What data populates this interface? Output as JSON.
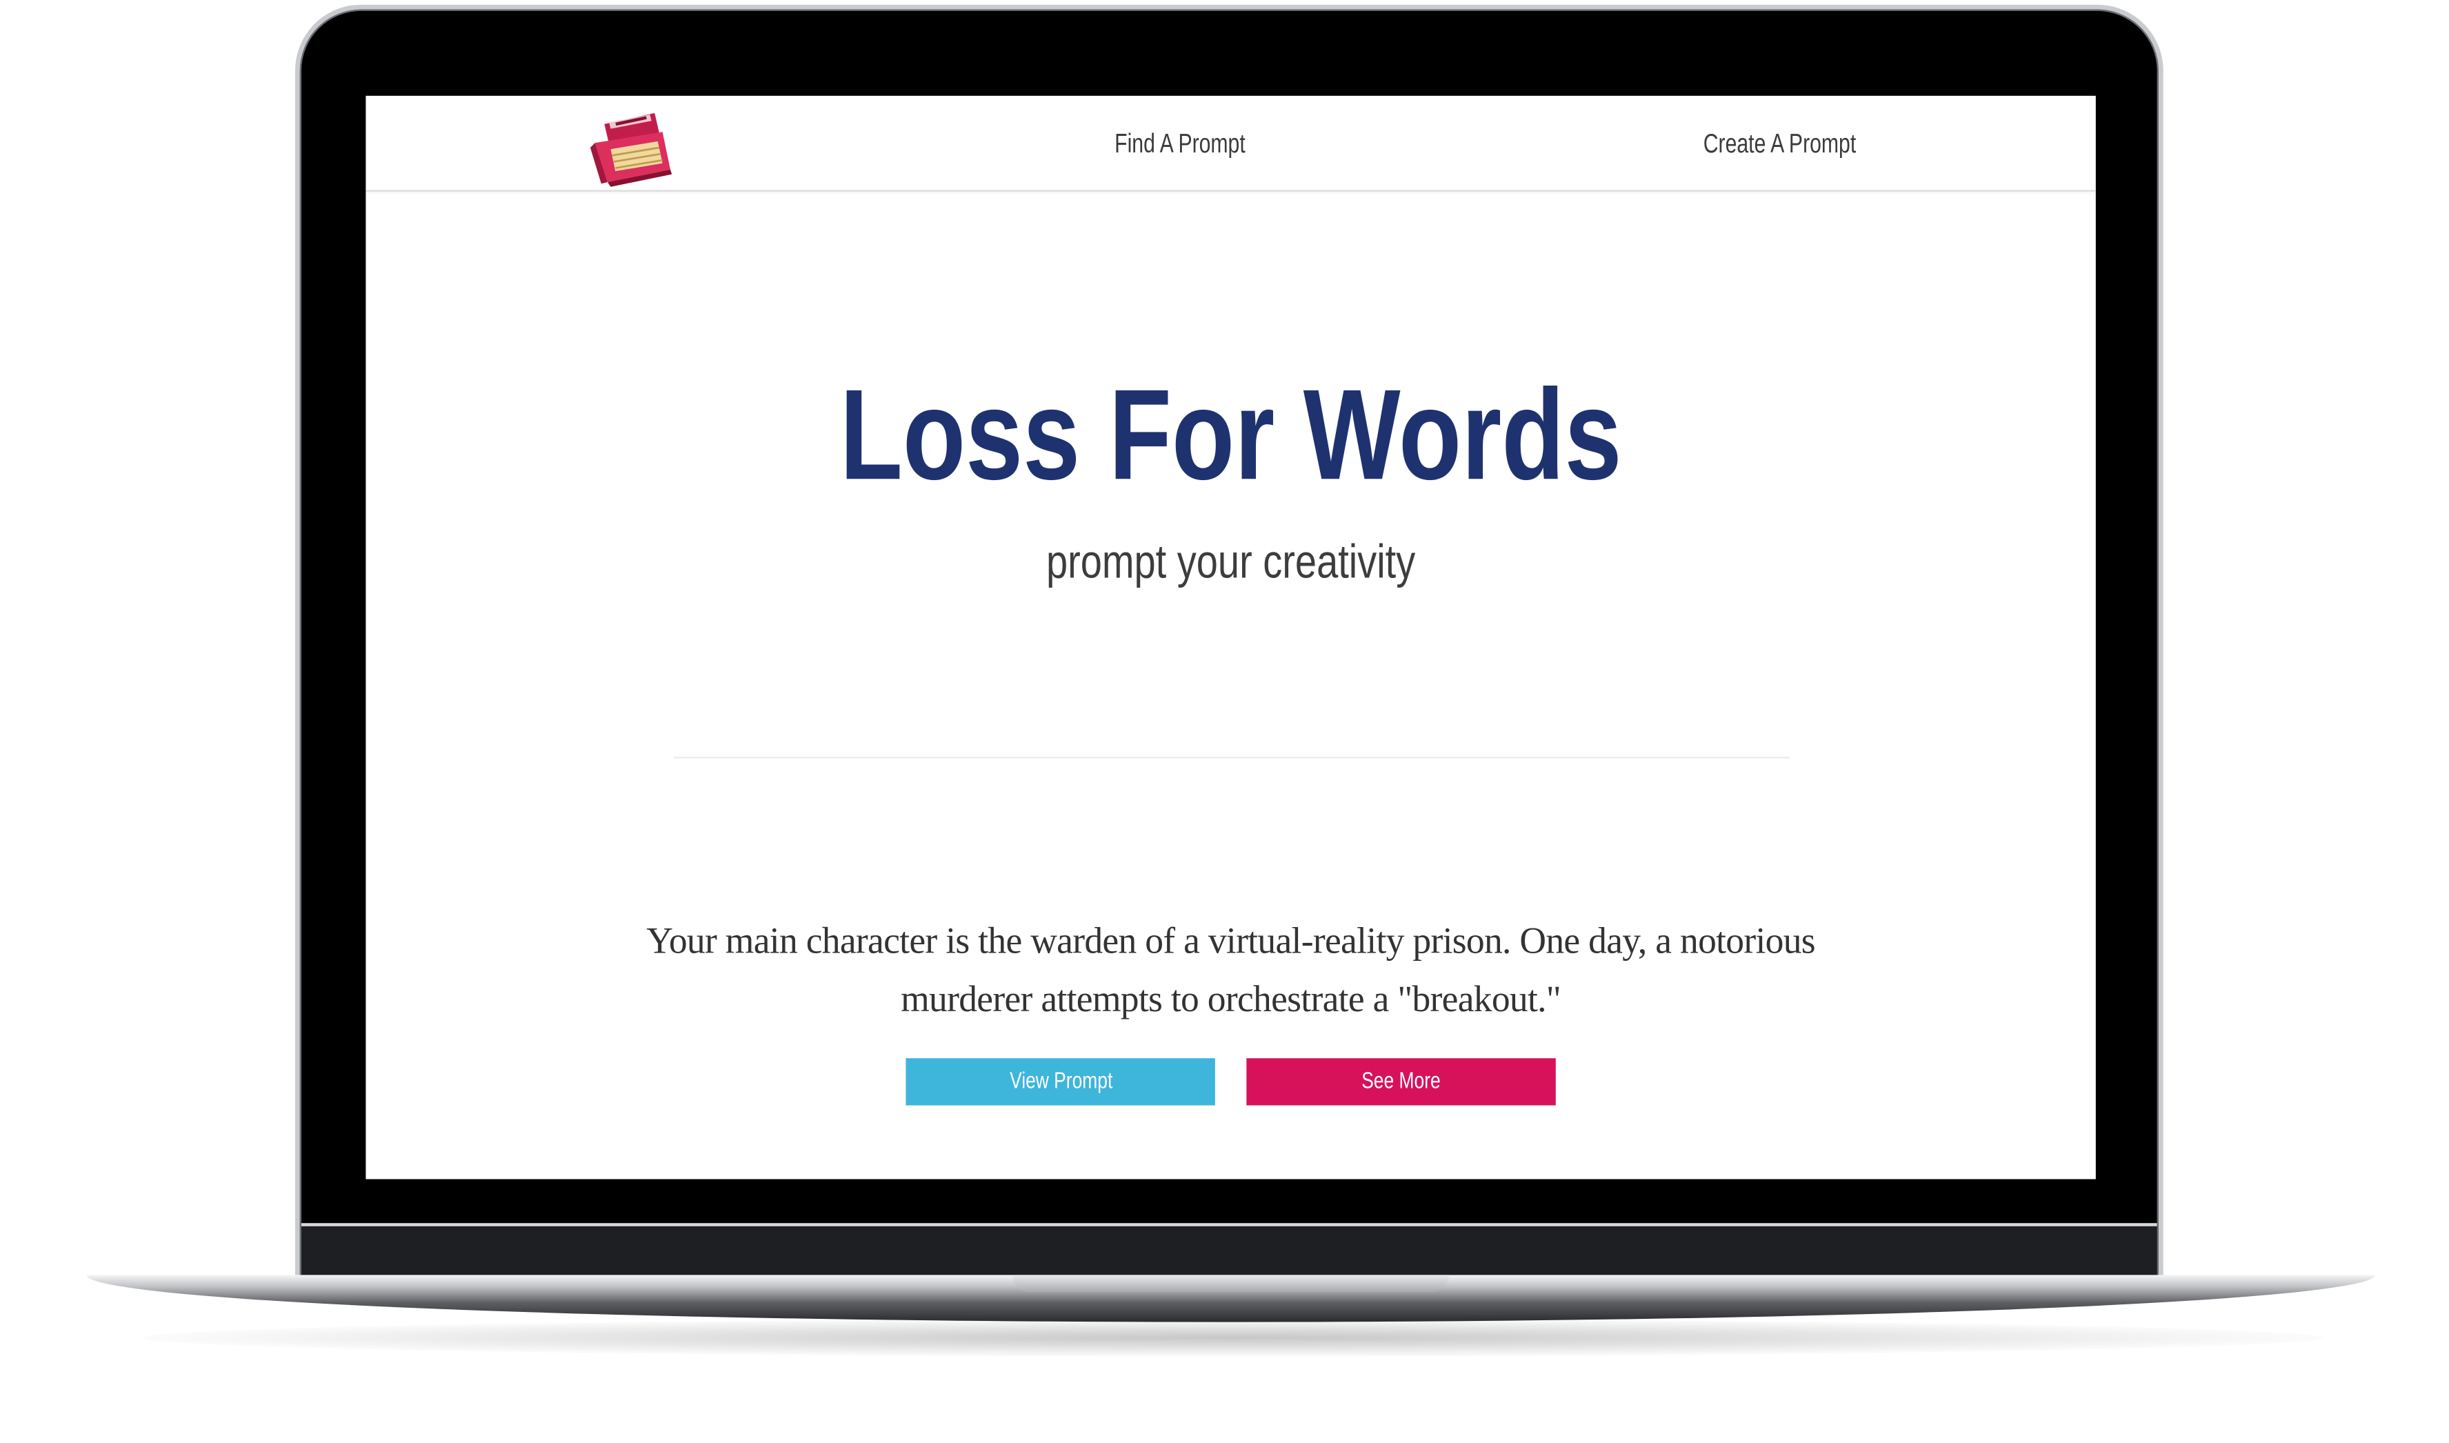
{
  "nav": {
    "logo_icon": "typewriter-icon",
    "links": [
      {
        "label": "Find A Prompt"
      },
      {
        "label": "Create A Prompt"
      }
    ]
  },
  "hero": {
    "title": "Loss For Words",
    "subtitle": "prompt your creativity"
  },
  "prompt": {
    "text": "Your main character is the warden of a virtual-reality prison. One day, a notorious murderer attempts to orchestrate a \"breakout.\""
  },
  "buttons": {
    "view_prompt": "View Prompt",
    "see_more": "See More"
  },
  "colors": {
    "title": "#1f3270",
    "view_prompt_button": "#3eb5db",
    "see_more_button": "#d8115b"
  }
}
